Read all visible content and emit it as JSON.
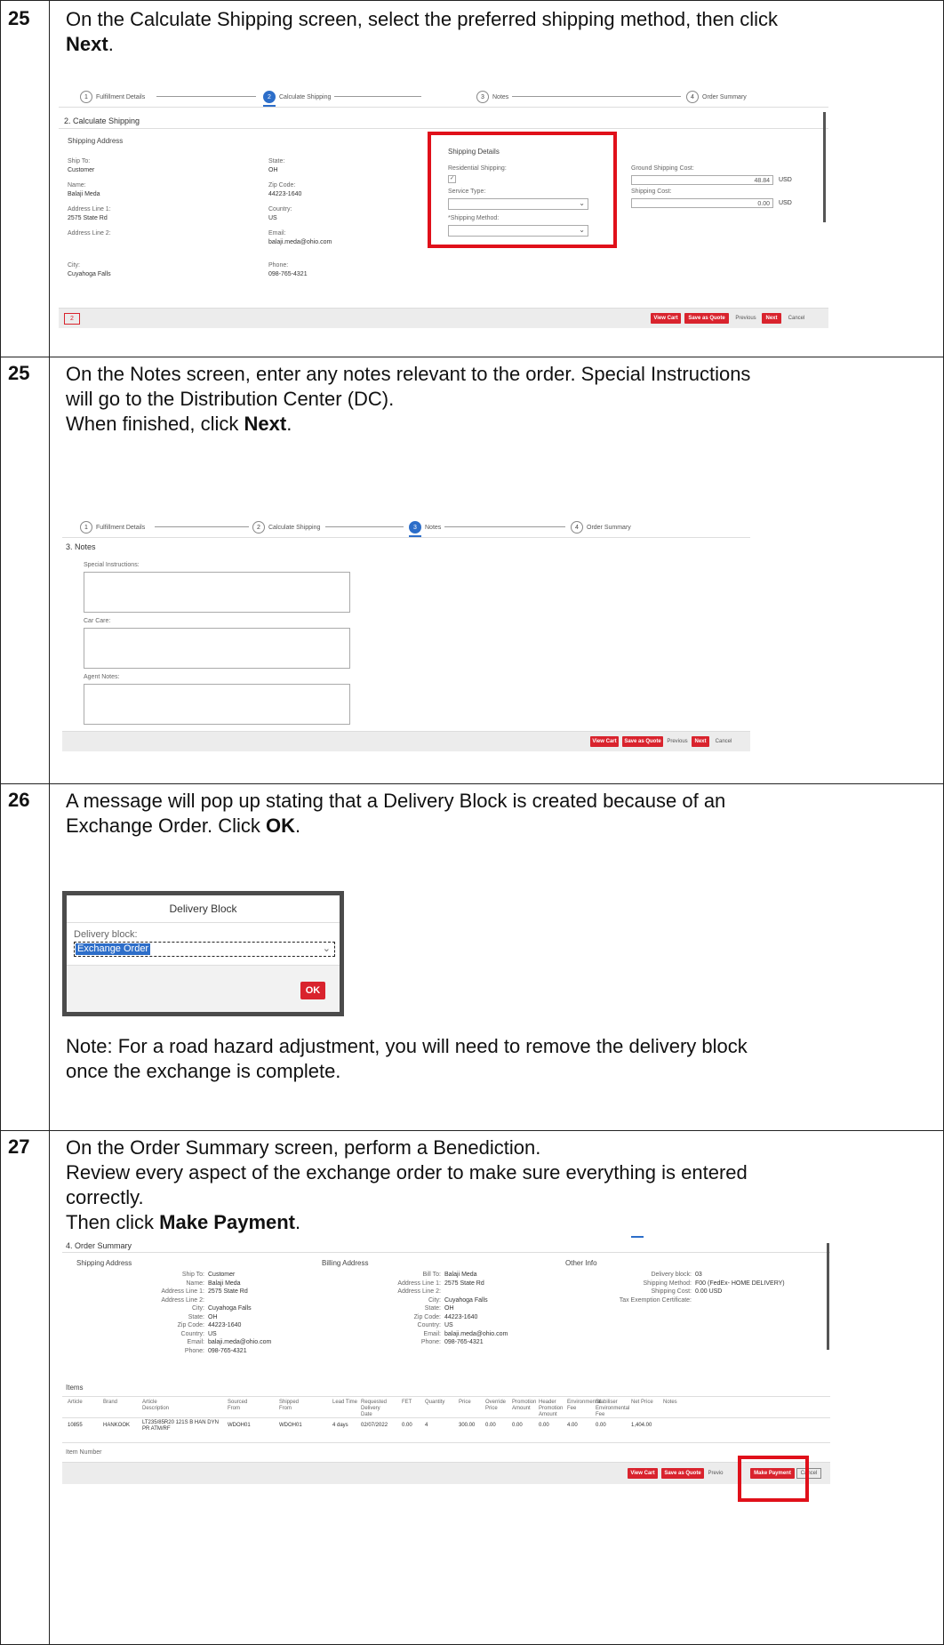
{
  "steps": [
    {
      "num": "25",
      "text_a": "On the Calculate Shipping screen, select the preferred shipping method, then click ",
      "bold": "Next",
      "text_b": "."
    },
    {
      "num": "25",
      "line1": "On the Notes screen, enter any notes relevant to the order. Special Instructions",
      "line2": "will go to the Distribution Center (DC).",
      "line3a": "When finished, click ",
      "bold": "Next",
      "line3b": "."
    },
    {
      "num": "26",
      "line1": "A message will pop up stating that a Delivery Block is created because of an",
      "line2a": "Exchange Order. Click ",
      "bold": "OK",
      "line2b": ".",
      "note_bold": "Note:",
      "note_line1": " For a road hazard adjustment, you will need to remove the delivery block",
      "note_line2": "once the exchange is complete."
    },
    {
      "num": "27",
      "line1": "On the Order Summary screen, perform a Benediction.",
      "line2": "Review every aspect of the exchange order to make sure everything is entered",
      "line3": "correctly.",
      "line4a": "Then click ",
      "bold": "Make Payment",
      "line4b": "."
    }
  ],
  "stepper": [
    {
      "n": "1",
      "label": "Fulfillment Details"
    },
    {
      "n": "2",
      "label": "Calculate Shipping"
    },
    {
      "n": "3",
      "label": "Notes"
    },
    {
      "n": "4",
      "label": "Order Summary"
    }
  ],
  "calc": {
    "title": "2. Calculate Shipping",
    "shipping_address": "Shipping Address",
    "ship_to_l": "Ship To:",
    "ship_to_v": "Customer",
    "name_l": "Name:",
    "name_v": "Balaji Meda",
    "addr1_l": "Address Line 1:",
    "addr1_v": "2575 State Rd",
    "addr2_l": "Address Line 2:",
    "city_l": "City:",
    "city_v": "Cuyahoga Falls",
    "state_l": "State:",
    "state_v": "OH",
    "zip_l": "Zip Code:",
    "zip_v": "44223-1640",
    "country_l": "Country:",
    "country_v": "US",
    "email_l": "Email:",
    "email_v": "balaji.meda@ohio.com",
    "phone_l": "Phone:",
    "phone_v": "098-765-4321",
    "shipping_details": "Shipping Details",
    "residential_l": "Residential Shipping:",
    "service_l": "Service Type:",
    "method_l": "*Shipping Method:",
    "ground_l": "Ground Shipping Cost:",
    "ground_v": "48.84",
    "usd": "USD",
    "cost_l": "Shipping Cost:",
    "cost_v": "0.00",
    "badge": "2"
  },
  "buttons": {
    "view_cart": "View Cart",
    "save_quote": "Save as Quote",
    "previous": "Previous",
    "next": "Next",
    "cancel": "Cancel",
    "make_payment": "Make Payment",
    "ok": "OK",
    "previous_trunc": "Previo"
  },
  "notes": {
    "title": "3. Notes",
    "special_l": "Special Instructions:",
    "carcare_l": "Car Care:",
    "agent_l": "Agent Notes:"
  },
  "modal": {
    "title": "Delivery Block",
    "field_l": "Delivery block:",
    "field_v": "Exchange Order"
  },
  "summary": {
    "title": "4. Order Summary",
    "shipping_address": "Shipping Address",
    "billing_address": "Billing Address",
    "other_info": "Other Info",
    "ship_rows": [
      [
        "Ship To:",
        "Customer"
      ],
      [
        "Name:",
        "Balaji Meda"
      ],
      [
        "Address Line 1:",
        "2575 State Rd"
      ],
      [
        "Address Line 2:",
        ""
      ],
      [
        "City:",
        "Cuyahoga Falls"
      ],
      [
        "State:",
        "OH"
      ],
      [
        "Zip Code:",
        "44223-1640"
      ],
      [
        "Country:",
        "US"
      ],
      [
        "Email:",
        "balaji.meda@ohio.com"
      ],
      [
        "Phone:",
        "098-765-4321"
      ]
    ],
    "bill_rows": [
      [
        "Bill To:",
        "Balaji Meda"
      ],
      [
        "Address Line 1:",
        "2575 State Rd"
      ],
      [
        "Address Line 2:",
        ""
      ],
      [
        "City:",
        "Cuyahoga Falls"
      ],
      [
        "State:",
        "OH"
      ],
      [
        "Zip Code:",
        "44223-1640"
      ],
      [
        "Country:",
        "US"
      ],
      [
        "Email:",
        "balaji.meda@ohio.com"
      ],
      [
        "Phone:",
        "098-765-4321"
      ]
    ],
    "other_rows": [
      [
        "Delivery block:",
        "03"
      ],
      [
        "Shipping Method:",
        "F00 (FedEx- HOME DELIVERY)"
      ],
      [
        "Shipping Cost:",
        "0.00 USD"
      ],
      [
        "Tax Exemption Certificate:",
        ""
      ]
    ],
    "items_l": "Items",
    "columns": [
      "Article",
      "Brand",
      "Article Description",
      "Sourced From",
      "Shipped From",
      "Lead Time",
      "Requested Delivery Date",
      "FET",
      "Quantity",
      "Price",
      "Override Price",
      "Promotion Amount",
      "Header Promotion Amount",
      "Environmental Fee",
      "Stabiliser Environmental Fee",
      "Net Price",
      "Notes"
    ],
    "row": [
      "10855",
      "HANKOOK",
      "LT235/85R20 121S B HAN DYN PR ATM/RF",
      "WDOH01",
      "WDOH01",
      "4 days",
      "02/07/2022",
      "0.00",
      "4",
      "300.00",
      "0.00",
      "0.00",
      "0.00",
      "4.00",
      "0.00",
      "1,404.00",
      ""
    ],
    "item_number_l": "Item Number"
  }
}
